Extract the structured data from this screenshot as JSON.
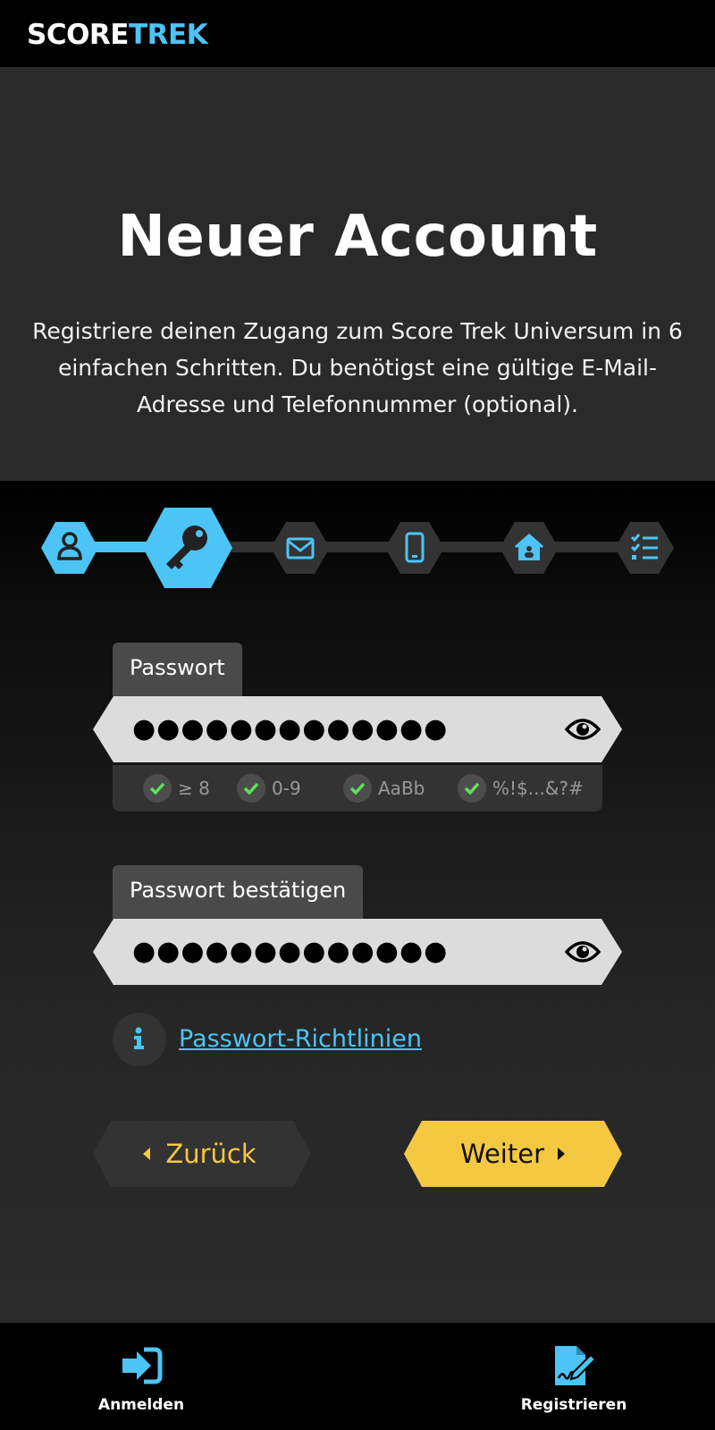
{
  "brand": {
    "name_part1": "SCORE",
    "name_part2": "TREK",
    "accent_color": "#4cc4f6"
  },
  "hero": {
    "title": "Neuer Account",
    "description": "Registriere deinen Zugang zum Score Trek Universum in 6 einfachen Schritten. Du benötigst eine gültige E-Mail-Adresse und Telefonnummer (optional)."
  },
  "stepper": {
    "current_step": 2,
    "total_steps": 6,
    "steps": [
      {
        "icon": "user-icon",
        "state": "completed"
      },
      {
        "icon": "key-icon",
        "state": "current"
      },
      {
        "icon": "envelope-icon",
        "state": "pending"
      },
      {
        "icon": "mobile-icon",
        "state": "pending"
      },
      {
        "icon": "house-icon",
        "state": "pending"
      },
      {
        "icon": "checklist-icon",
        "state": "pending"
      }
    ]
  },
  "password": {
    "label": "Passwort",
    "masked_value": "●●●●●●●●●●●●●",
    "requirements": [
      {
        "text": "≥ 8",
        "met": true
      },
      {
        "text": "0-9",
        "met": true
      },
      {
        "text": "AaBb",
        "met": true
      },
      {
        "text": "%!$...&?#",
        "met": true
      }
    ]
  },
  "password_confirm": {
    "label": "Passwort bestätigen",
    "masked_value": "●●●●●●●●●●●●●"
  },
  "policy_link": {
    "text": "Passwort-Richtlinien"
  },
  "buttons": {
    "back": "Zurück",
    "next": "Weiter"
  },
  "bottom_nav": {
    "items": [
      {
        "label": "Anmelden",
        "icon": "sign-in-icon"
      },
      {
        "label": "Registrieren",
        "icon": "signature-document-icon"
      }
    ]
  },
  "colors": {
    "accent_blue": "#4cc4f6",
    "accent_yellow": "#f5c842",
    "check_green": "#5ee05a"
  }
}
